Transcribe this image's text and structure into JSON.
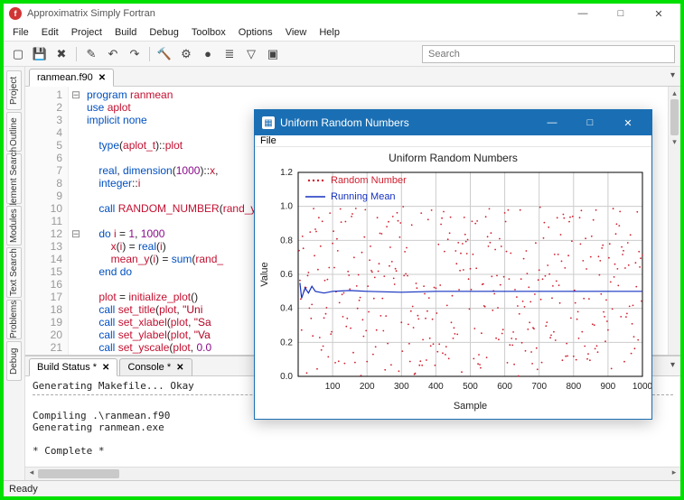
{
  "app": {
    "title": "Approximatrix Simply Fortran"
  },
  "window_controls": {
    "min": "—",
    "max": "□",
    "close": "✕"
  },
  "menubar": [
    "File",
    "Edit",
    "Project",
    "Build",
    "Debug",
    "Toolbox",
    "Options",
    "View",
    "Help"
  ],
  "toolbar": {
    "search_placeholder": "Search"
  },
  "leftrail": [
    "Project",
    "Outline",
    "Element Search",
    "Modules",
    "Text Search",
    "Problems",
    "Debug"
  ],
  "editor": {
    "tab": "ranmean.f90",
    "lines": [
      "program ranmean",
      "use aplot",
      "implicit none",
      "",
      "    type(aplot_t)::plot",
      "",
      "    real, dimension(1000)::x,",
      "    integer::i",
      "",
      "    call RANDOM_NUMBER(rand_y",
      "",
      "    do i = 1, 1000",
      "        x(i) = real(i)",
      "        mean_y(i) = sum(rand_",
      "    end do",
      "",
      "    plot = initialize_plot()",
      "    call set_title(plot, \"Uni",
      "    call set_xlabel(plot, \"Sa",
      "    call set_ylabel(plot, \"Va",
      "    call set_yscale(plot, 0.0"
    ]
  },
  "bottom": {
    "tabs": [
      {
        "label": "Build Status *",
        "active": true
      },
      {
        "label": "Console *",
        "active": false
      }
    ],
    "lines": [
      "Generating Makefile... Okay",
      "---",
      "Compiling .\\ranmean.f90",
      "Generating ranmean.exe",
      "",
      "* Complete *"
    ]
  },
  "status": {
    "text": "Ready"
  },
  "plotwin": {
    "title": "Uniform Random Numbers",
    "menu": [
      "File"
    ]
  },
  "chart_data": {
    "type": "scatter+line",
    "title": "Uniform Random Numbers",
    "xlabel": "Sample",
    "ylabel": "Value",
    "xlim": [
      0,
      1000
    ],
    "ylim": [
      0.0,
      1.2
    ],
    "xticks": [
      100,
      200,
      300,
      400,
      500,
      600,
      700,
      800,
      900,
      1000
    ],
    "yticks": [
      0.0,
      0.2,
      0.4,
      0.6,
      0.8,
      1.0,
      1.2
    ],
    "legend": [
      {
        "name": "Random Number",
        "color": "#d02030",
        "kind": "scatter"
      },
      {
        "name": "Running Mean",
        "color": "#1530c0",
        "kind": "line"
      }
    ],
    "series": [
      {
        "name": "Random Number",
        "kind": "scatter",
        "n": 1000,
        "distribution": "uniform",
        "range": [
          0,
          1
        ]
      },
      {
        "name": "Running Mean",
        "kind": "line",
        "x": [
          5,
          10,
          20,
          30,
          40,
          50,
          75,
          100,
          150,
          200,
          300,
          400,
          500,
          600,
          700,
          800,
          900,
          1000
        ],
        "y": [
          0.55,
          0.46,
          0.52,
          0.49,
          0.53,
          0.5,
          0.49,
          0.5,
          0.505,
          0.5,
          0.495,
          0.5,
          0.5,
          0.5,
          0.5,
          0.5,
          0.5,
          0.5
        ]
      }
    ]
  }
}
